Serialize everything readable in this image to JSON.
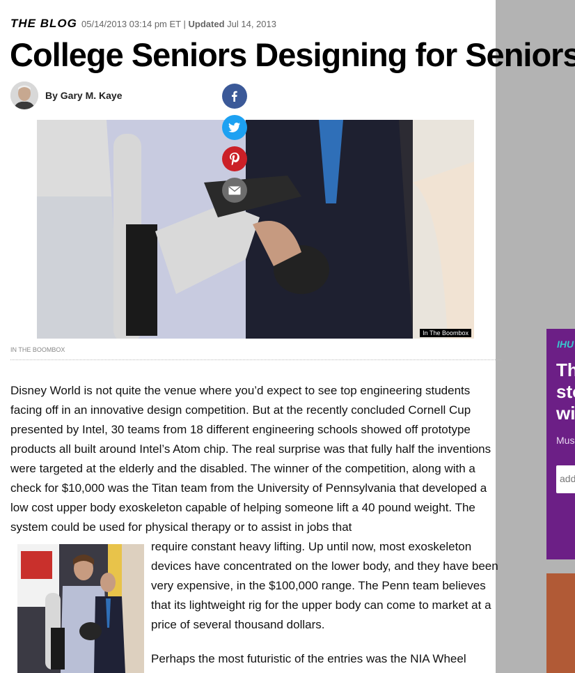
{
  "header": {
    "blog_tag": "THE BLOG",
    "date": "05/14/2013 03:14 pm ET",
    "separator": "|",
    "updated_label": "Updated",
    "updated_date": "Jul 14, 2013"
  },
  "article": {
    "title": "College Seniors Designing for Seniors",
    "byline": "By Gary M. Kaye",
    "hero_credit": "In The Boombox",
    "caption": "IN THE BOOMBOX",
    "paragraph1": "Disney World is not quite the venue where you’d expect to see top engineering students facing off in an innovative design competition. But at the recently concluded Cornell Cup presented by Intel, 30 teams from 18 different engineering schools showed off prototype products all built around Intel’s Atom chip. The real surprise was that fully half the inventions were targeted at the elderly and the disabled. The winner of the competition, along with a check for $10,000 was the Titan team from the University of Pennsylvania that developed a low cost upper body exoskeleton capable of helping someone lift a 40 pound weight. The system could be used for physical therapy or to assist in jobs that",
    "paragraph2": "require constant heavy lifting. Up until now, most exoskeleton devices have concentrated on the lower body, and they have been very expensive, in the $100,000 range. The Penn team believes that its lightweight rig for the upper body can come to market at a price of several thousand dollars.",
    "paragraph3": "Perhaps the most futuristic of the entries was the NIA Wheel"
  },
  "share": {
    "icons": [
      "facebook-icon",
      "twitter-icon",
      "pinterest-icon",
      "mail-icon"
    ]
  },
  "ad": {
    "brand": "IHU",
    "headline": "Th\nsto\nwi",
    "sub": "Mus",
    "field_placeholder": "add"
  },
  "colors": {
    "facebook": "#3b5998",
    "twitter": "#1da1f2",
    "pinterest": "#cb2027",
    "mail": "#6d6d6d",
    "ad_purple": "#6c1f86",
    "ad_orange": "#b15a36",
    "side_gray": "#b3b3b3"
  }
}
